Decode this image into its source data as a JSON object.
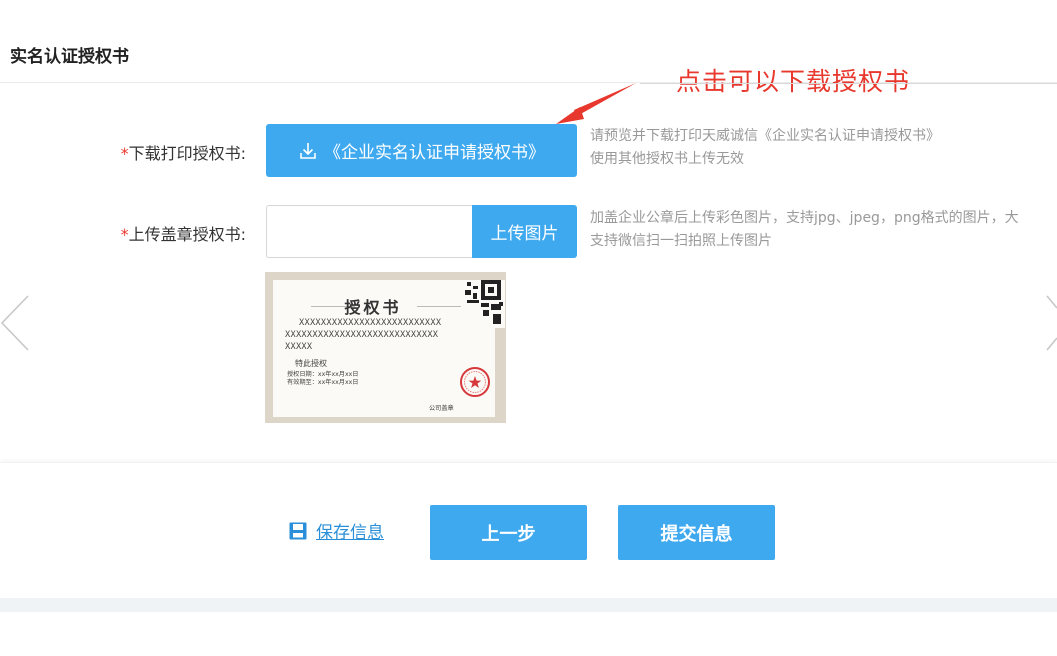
{
  "header": {
    "title": "实名认证授权书"
  },
  "annotation": {
    "text": "点击可以下载授权书",
    "color": "#e8382d"
  },
  "form": {
    "download": {
      "required_mark": "*",
      "label": "下载打印授权书:",
      "button_label": "《企业实名认证申请授权书》",
      "hint_lines": [
        "请预览并下载打印天威诚信《企业实名认证申请授权书》",
        "使用其他授权书上传无效"
      ]
    },
    "upload": {
      "required_mark": "*",
      "label": "上传盖章授权书:",
      "input_value": "",
      "button_label": "上传图片",
      "hint_lines": [
        "加盖企业公章后上传彩色图片，支持jpg、jpeg，png格式的图片，大",
        "支持微信扫一扫拍照上传图片"
      ]
    },
    "sample": {
      "title": "授权书",
      "x_lines": [
        "XXXXXXXXXXXXXXXXXXXXXXXXXX",
        "XXXXXXXXXXXXXXXXXXXXXXXXXXXX",
        "XXXXX"
      ],
      "grant_text": "特此授权",
      "date_lines": [
        "授权日期：xx年xx月xx日",
        "有效期至：xx年xx月xx日"
      ],
      "stamp_text": "公司盖章"
    }
  },
  "footer": {
    "save_label": "保存信息",
    "prev_label": "上一步",
    "submit_label": "提交信息"
  },
  "colors": {
    "accent": "#3fa9ef",
    "required": "#e8382d",
    "link": "#2a8fd8"
  }
}
